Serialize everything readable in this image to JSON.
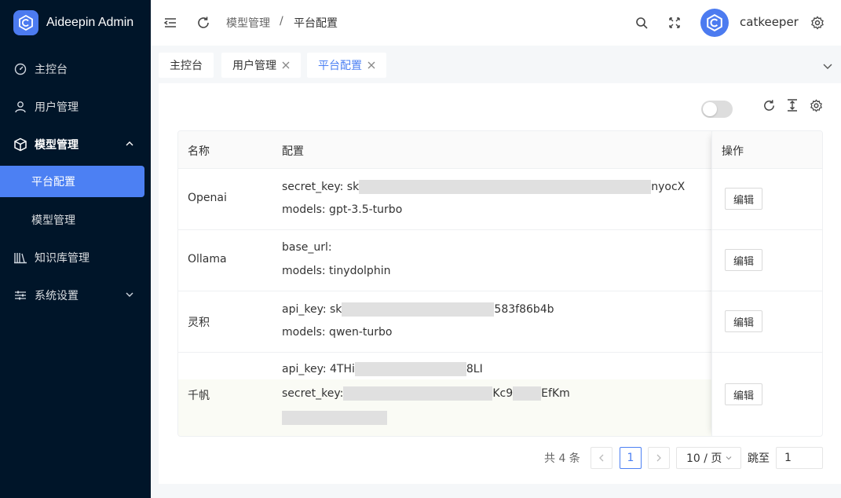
{
  "app": {
    "title": "Aideepin Admin"
  },
  "sidebar": {
    "items": [
      {
        "label": "主控台",
        "icon": "dashboard-icon"
      },
      {
        "label": "用户管理",
        "icon": "user-icon"
      },
      {
        "label": "模型管理",
        "icon": "cube-icon",
        "expanded": true
      },
      {
        "label": "平台配置",
        "active": true
      },
      {
        "label": "模型管理"
      },
      {
        "label": "知识库管理",
        "icon": "library-icon"
      },
      {
        "label": "系统设置",
        "icon": "sliders-icon",
        "expanded": false
      }
    ]
  },
  "header": {
    "breadcrumb": [
      "模型管理",
      "平台配置"
    ],
    "separator": "/",
    "username": "catkeeper"
  },
  "tabs": [
    {
      "label": "主控台",
      "closable": false
    },
    {
      "label": "用户管理",
      "closable": true
    },
    {
      "label": "平台配置",
      "closable": true,
      "active": true
    }
  ],
  "table": {
    "columns": [
      "名称",
      "配置",
      "操作"
    ],
    "rows": [
      {
        "name": "Openai",
        "lines": [
          {
            "prefix": "secret_key: sk",
            "suffix": "nyocX"
          },
          {
            "prefix": "models: gpt-3.5-turbo",
            "suffix": ""
          }
        ],
        "action": "编辑"
      },
      {
        "name": "Ollama",
        "lines": [
          {
            "prefix": "base_url:",
            "suffix": ""
          },
          {
            "prefix": "models: tinydolphin",
            "suffix": ""
          }
        ],
        "action": "编辑"
      },
      {
        "name": "灵积",
        "lines": [
          {
            "prefix": "api_key: sk",
            "suffix": "583f86b4b"
          },
          {
            "prefix": "models: qwen-turbo",
            "suffix": ""
          }
        ],
        "action": "编辑"
      },
      {
        "name": "千帆",
        "lines": [
          {
            "prefix": "api_key: 4THi",
            "suffix": "8LI"
          },
          {
            "prefix": "secret_key:",
            "suffix": "Kc9",
            "suffix2": "EfKm"
          },
          {
            "prefix": "",
            "suffix": ""
          }
        ],
        "action": "编辑"
      }
    ]
  },
  "pagination": {
    "total": "共 4 条",
    "current_page": "1",
    "page_size": "10 / 页",
    "jump_label": "跳至",
    "jump_value": "1"
  },
  "colors": {
    "sidebar_bg": "#001529",
    "accent": "#4c80f3"
  }
}
